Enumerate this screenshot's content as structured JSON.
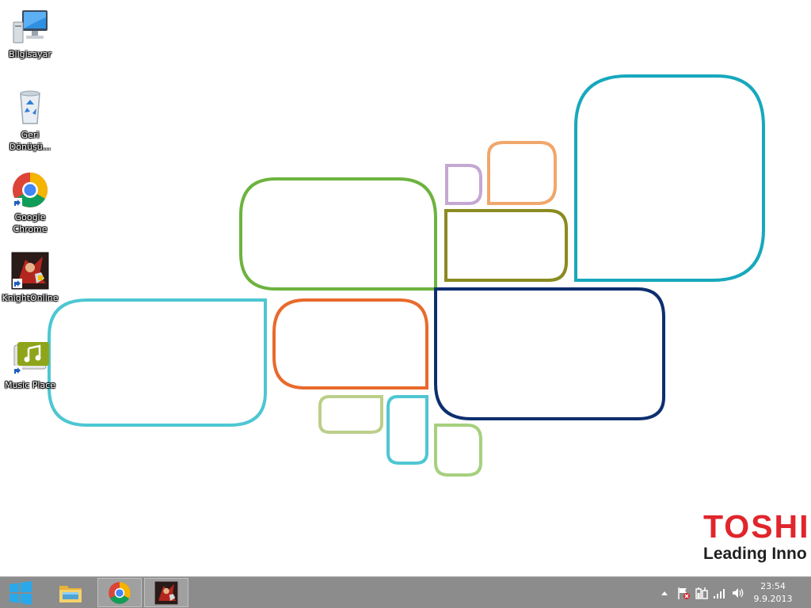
{
  "desktop": {
    "icons": [
      {
        "id": "computer",
        "label": "Bilgisayar",
        "icon": "computer-icon"
      },
      {
        "id": "recycle-bin",
        "label": "Geri Dönüşü...",
        "icon": "recycle-bin-icon"
      },
      {
        "id": "chrome",
        "label": "Google Chrome",
        "icon": "chrome-icon"
      },
      {
        "id": "knightonline",
        "label": "KnightOnline",
        "icon": "game-icon"
      },
      {
        "id": "music-place",
        "label": "Music Place",
        "icon": "music-icon"
      }
    ]
  },
  "wallpaper": {
    "brand": "TOSHI",
    "tagline": "Leading Inno",
    "colors": {
      "green": "#6db33f",
      "cyan": "#4ec6d3",
      "orange": "#e86a2c",
      "peach": "#f0a76c",
      "lilac": "#c4a8d2",
      "olive": "#8a8b1f",
      "teal": "#17a8bd",
      "navy": "#0d2f6e",
      "sage": "#bccf8a",
      "lightgreen": "#a6d07e",
      "brand_red": "#e0262c"
    }
  },
  "taskbar": {
    "start_icon": "windows-logo-icon",
    "pinned": [
      {
        "id": "explorer",
        "icon": "file-explorer-icon"
      },
      {
        "id": "chrome",
        "icon": "chrome-icon",
        "active": true
      },
      {
        "id": "knightonline",
        "icon": "game-icon",
        "active": true
      }
    ],
    "tray": {
      "icons": [
        "show-hidden-icons-icon",
        "action-center-flag-icon",
        "power-icon",
        "network-signal-icon",
        "volume-icon"
      ],
      "time": "23:54",
      "date": "9.9.2013"
    }
  }
}
